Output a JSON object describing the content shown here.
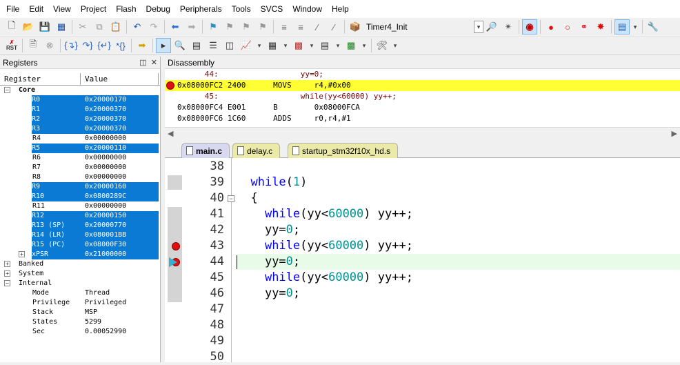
{
  "menu": [
    "File",
    "Edit",
    "View",
    "Project",
    "Flash",
    "Debug",
    "Peripherals",
    "Tools",
    "SVCS",
    "Window",
    "Help"
  ],
  "toolbar": {
    "target": "Timer4_Init",
    "rst_label": "RST"
  },
  "registers": {
    "title": "Registers",
    "col_register": "Register",
    "col_value": "Value",
    "core_label": "Core",
    "core": [
      {
        "name": "R0",
        "value": "0x20000170",
        "selected": true
      },
      {
        "name": "R1",
        "value": "0x20000370",
        "selected": true
      },
      {
        "name": "R2",
        "value": "0x20000370",
        "selected": true
      },
      {
        "name": "R3",
        "value": "0x20000370",
        "selected": true
      },
      {
        "name": "R4",
        "value": "0x00000000",
        "selected": false
      },
      {
        "name": "R5",
        "value": "0x20000110",
        "selected": true
      },
      {
        "name": "R6",
        "value": "0x00000000",
        "selected": false
      },
      {
        "name": "R7",
        "value": "0x00000000",
        "selected": false
      },
      {
        "name": "R8",
        "value": "0x00000000",
        "selected": false
      },
      {
        "name": "R9",
        "value": "0x20000160",
        "selected": true
      },
      {
        "name": "R10",
        "value": "0x0800289C",
        "selected": true
      },
      {
        "name": "R11",
        "value": "0x00000000",
        "selected": false
      },
      {
        "name": "R12",
        "value": "0x20000150",
        "selected": true
      },
      {
        "name": "R13 (SP)",
        "value": "0x20000770",
        "selected": true
      },
      {
        "name": "R14 (LR)",
        "value": "0x080001BB",
        "selected": true
      },
      {
        "name": "R15 (PC)",
        "value": "0x08000F30",
        "selected": true
      },
      {
        "name": "xPSR",
        "value": "0x21000000",
        "selected": true
      }
    ],
    "banked_label": "Banked",
    "system_label": "System",
    "internal_label": "Internal",
    "internal": [
      {
        "name": "Mode",
        "value": "Thread"
      },
      {
        "name": "Privilege",
        "value": "Privileged"
      },
      {
        "name": "Stack",
        "value": "MSP"
      },
      {
        "name": "States",
        "value": "5299"
      },
      {
        "name": "Sec",
        "value": "0.00052990"
      }
    ]
  },
  "disassembly": {
    "title": "Disassembly",
    "lines": [
      {
        "text": "      44:                  yy=0;",
        "kind": "src"
      },
      {
        "text": "0x08000FC2 2400      MOVS     r4,#0x00",
        "kind": "hl"
      },
      {
        "text": "      45:                  while(yy<60000) yy++;",
        "kind": "src"
      },
      {
        "text": "0x08000FC4 E001      B        0x08000FCA",
        "kind": "asm"
      },
      {
        "text": "0x08000FC6 1C60      ADDS     r0,r4,#1",
        "kind": "asm"
      }
    ]
  },
  "tabs": [
    {
      "label": "main.c",
      "active": true
    },
    {
      "label": "delay.c",
      "active": false
    },
    {
      "label": "startup_stm32f10x_hd.s",
      "active": false
    }
  ],
  "editor": {
    "line_numbers": [
      "38",
      "39",
      "40",
      "41",
      "42",
      "43",
      "44",
      "45",
      "46",
      "47",
      "48",
      "49",
      "50"
    ],
    "code": [
      {
        "kw": "",
        "rest": ""
      },
      {
        "kw": "while",
        "rest": "(",
        "num": "1",
        "tail": ")"
      },
      {
        "kw": "",
        "rest": "{"
      },
      {
        "kw": "while",
        "rest": "(yy<",
        "num": "60000",
        "tail": ") yy++;"
      },
      {
        "kw": "",
        "rest": "yy=",
        "num": "0",
        "tail": ";"
      },
      {
        "kw": "while",
        "rest": "(yy<",
        "num": "60000",
        "tail": ") yy++;"
      },
      {
        "kw": "",
        "rest": "yy=",
        "num": "0",
        "tail": ";"
      },
      {
        "kw": "while",
        "rest": "(yy<",
        "num": "60000",
        "tail": ") yy++;"
      },
      {
        "kw": "",
        "rest": "yy=",
        "num": "0",
        "tail": ";"
      },
      {
        "kw": "",
        "rest": ""
      },
      {
        "kw": "",
        "rest": ""
      },
      {
        "kw": "",
        "rest": ""
      },
      {
        "kw": "",
        "rest": ""
      }
    ]
  }
}
